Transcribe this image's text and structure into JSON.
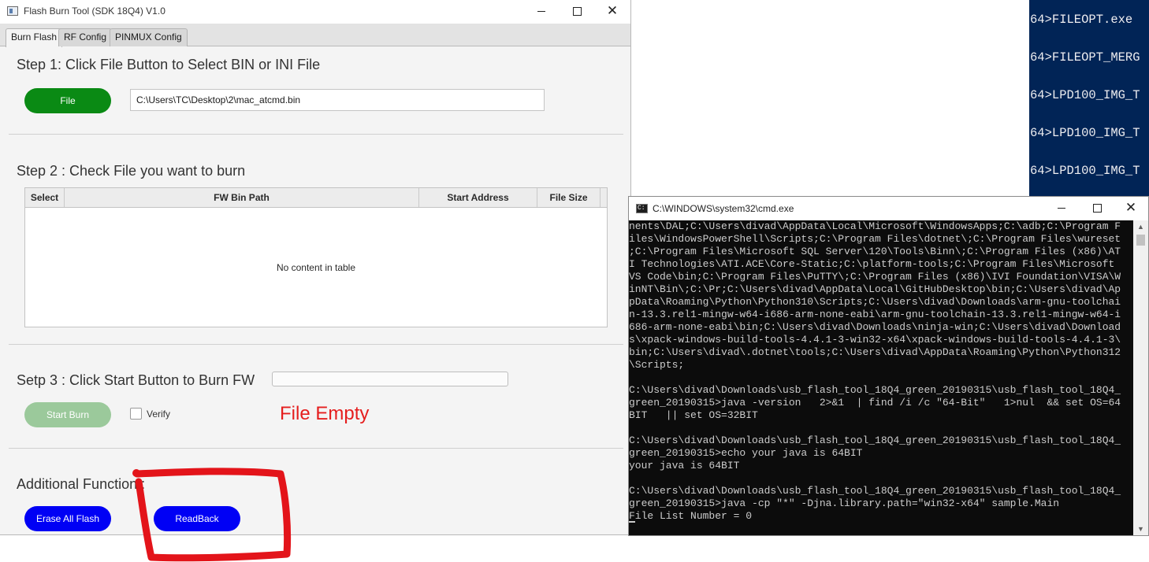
{
  "ps_strip": {
    "lines": [
      "64>FILEOPT.exe",
      "64>FILEOPT_MERG",
      "64>LPD100_IMG_T",
      "64>LPD100_IMG_T",
      "64>LPD100_IMG_T"
    ]
  },
  "flash_window": {
    "title": "Flash Burn Tool (SDK 18Q4) V1.0",
    "controls": {
      "minimize": "—",
      "maximize": "□",
      "close": "✕"
    },
    "tabs": [
      "Burn Flash",
      "RF Config",
      "PINMUX Config"
    ],
    "active_tab": "Burn Flash",
    "step1": {
      "title": "Step 1: Click File Button to Select BIN or INI File",
      "file_button": "File",
      "file_path": "C:\\Users\\TC\\Desktop\\2\\mac_atcmd.bin"
    },
    "step2": {
      "title": "Step 2 : Check File you want to burn",
      "columns": [
        "Select",
        "FW Bin Path",
        "Start Address",
        "File Size"
      ],
      "empty_text": "No content in table"
    },
    "step3": {
      "title": "Setp 3 : Click Start Button to Burn FW",
      "progress": 0,
      "start_button": "Start Burn",
      "verify_label": "Verify",
      "verify_checked": false,
      "status_message": "File Empty"
    },
    "additional": {
      "title": "Additional Function :",
      "erase_button": "Erase All Flash",
      "readback_button": "ReadBack"
    }
  },
  "cmd_window": {
    "title": "C:\\WINDOWS\\system32\\cmd.exe",
    "controls": {
      "minimize": "—",
      "maximize": "□",
      "close": "✕"
    },
    "lines": [
      "nents\\DAL;C:\\Users\\divad\\AppData\\Local\\Microsoft\\WindowsApps;C:\\adb;C:\\Program F",
      "iles\\WindowsPowerShell\\Scripts;C:\\Program Files\\dotnet\\;C:\\Program Files\\wureset",
      ";C:\\Program Files\\Microsoft SQL Server\\120\\Tools\\Binn\\;C:\\Program Files (x86)\\AT",
      "I Technologies\\ATI.ACE\\Core-Static;C:\\platform-tools;C:\\Program Files\\Microsoft",
      "VS Code\\bin;C:\\Program Files\\PuTTY\\;C:\\Program Files (x86)\\IVI Foundation\\VISA\\W",
      "inNT\\Bin\\;C:\\Pr;C:\\Users\\divad\\AppData\\Local\\GitHubDesktop\\bin;C:\\Users\\divad\\Ap",
      "pData\\Roaming\\Python\\Python310\\Scripts;C:\\Users\\divad\\Downloads\\arm-gnu-toolchai",
      "n-13.3.rel1-mingw-w64-i686-arm-none-eabi\\arm-gnu-toolchain-13.3.rel1-mingw-w64-i",
      "686-arm-none-eabi\\bin;C:\\Users\\divad\\Downloads\\ninja-win;C:\\Users\\divad\\Download",
      "s\\xpack-windows-build-tools-4.4.1-3-win32-x64\\xpack-windows-build-tools-4.4.1-3\\",
      "bin;C:\\Users\\divad\\.dotnet\\tools;C:\\Users\\divad\\AppData\\Roaming\\Python\\Python312",
      "\\Scripts;",
      "",
      "C:\\Users\\divad\\Downloads\\usb_flash_tool_18Q4_green_20190315\\usb_flash_tool_18Q4_",
      "green_20190315>java -version   2>&1  | find /i /c \"64-Bit\"   1>nul  && set OS=64",
      "BIT   || set OS=32BIT",
      "",
      "C:\\Users\\divad\\Downloads\\usb_flash_tool_18Q4_green_20190315\\usb_flash_tool_18Q4_",
      "green_20190315>echo your java is 64BIT",
      "your java is 64BIT",
      "",
      "C:\\Users\\divad\\Downloads\\usb_flash_tool_18Q4_green_20190315\\usb_flash_tool_18Q4_",
      "green_20190315>java -cp \"*\" -Djna.library.path=\"win32-x64\" sample.Main",
      "File List Number = 0"
    ]
  },
  "colors": {
    "file_button": "#0a8a14",
    "start_button_disabled": "#9bc99b",
    "action_buttons": "#0000f5",
    "status_text": "#e51e1e",
    "annotation": "#e3141a",
    "powershell_bg": "#012456",
    "cmd_bg": "#0c0c0c"
  },
  "icons": {
    "flash_app": "app-window-icon",
    "cmd_app": "console-icon",
    "annotation": "red-highlight-box"
  }
}
